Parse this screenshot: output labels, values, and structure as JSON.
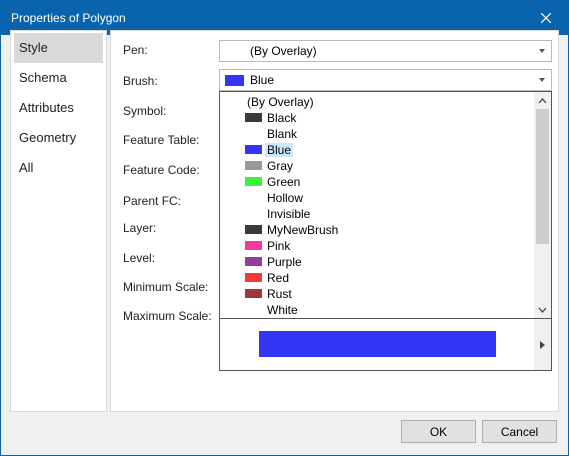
{
  "window": {
    "title": "Properties of Polygon"
  },
  "nav": {
    "items": [
      {
        "label": "Style",
        "selected": true
      },
      {
        "label": "Schema"
      },
      {
        "label": "Attributes"
      },
      {
        "label": "Geometry"
      },
      {
        "label": "All"
      }
    ]
  },
  "form": {
    "pen_label": "Pen:",
    "pen_value": "(By Overlay)",
    "brush_label": "Brush:",
    "brush_value": "Blue",
    "brush_color": "#3535f5",
    "symbol_label": "Symbol:",
    "feature_table_label": "Feature Table:",
    "feature_code_label": "Feature Code:",
    "parent_fc_label": "Parent FC:",
    "layer_label": "Layer:",
    "level_label": "Level:",
    "min_scale_label": "Minimum Scale:",
    "max_scale_label": "Maximum Scale:"
  },
  "dropdown": {
    "options": [
      {
        "label": "(By Overlay)",
        "color": null
      },
      {
        "label": "Black",
        "color": "#3a3a3a"
      },
      {
        "label": "Blank",
        "color": null
      },
      {
        "label": "Blue",
        "color": "#3535f5",
        "selected": true
      },
      {
        "label": "Gray",
        "color": "#999999"
      },
      {
        "label": "Green",
        "color": "#3cf03c"
      },
      {
        "label": "Hollow",
        "color": null
      },
      {
        "label": "Invisible",
        "color": null
      },
      {
        "label": "MyNewBrush",
        "color": "#3a3a3a"
      },
      {
        "label": "Pink",
        "color": "#f23a9c"
      },
      {
        "label": "Purple",
        "color": "#9a3a9a"
      },
      {
        "label": "Red",
        "color": "#f03a3a"
      },
      {
        "label": "Rust",
        "color": "#9c3838"
      },
      {
        "label": "White",
        "color": null
      }
    ],
    "preview_color": "#3535f5"
  },
  "buttons": {
    "ok": "OK",
    "cancel": "Cancel"
  }
}
